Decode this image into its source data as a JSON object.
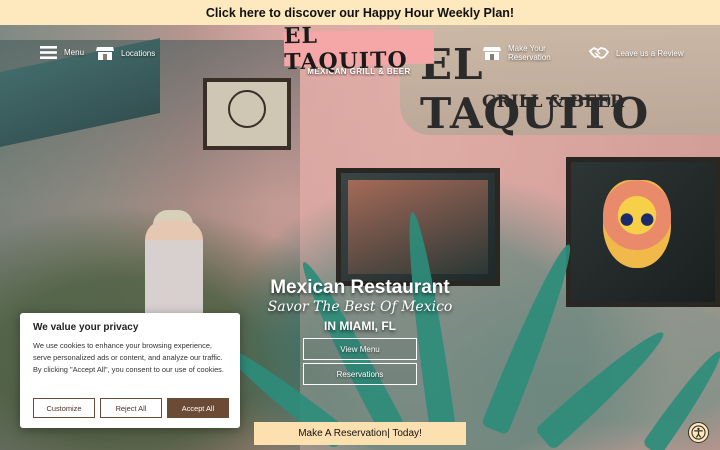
{
  "topbar": {
    "text": "Click here to discover our Happy Hour Weekly Plan!"
  },
  "nav": {
    "menu_label": "Menu",
    "locations_label": "Locations",
    "reservation_label_1": "Make Your",
    "reservation_label_2": "Reservation",
    "review_label": "Leave us a Review"
  },
  "logo": {
    "title": "EL TAQUITO",
    "subtitle": "MEXICAN GRILL & BEER"
  },
  "hero": {
    "title": "Mexican Restaurant",
    "subtitle": "Savor The Best Of Mexico",
    "location": "IN MIAMI, FL",
    "view_menu": "View Menu",
    "reservations": "Reservations"
  },
  "background_sign": {
    "main": "EL TAQUITO",
    "sub": "GRILL & BEER"
  },
  "reserve_bar": {
    "text": "Make A Reservation| Today!"
  },
  "cookie": {
    "title": "We value your privacy",
    "text": "We use cookies to enhance your browsing experience, serve personalized ads or content, and analyze our traffic. By clicking \"Accept All\", you consent to our use of cookies.",
    "customize": "Customize",
    "reject": "Reject All",
    "accept": "Accept All"
  },
  "colors": {
    "topbar": "#fde9bd",
    "logo_pink": "#f5a7a8",
    "accent_brown": "#6b4a36",
    "reserve_bar": "#fde0b0"
  },
  "icons": [
    "hamburger-menu-icon",
    "store-icon",
    "reservation-store-icon",
    "handshake-icon",
    "accessibility-icon"
  ]
}
